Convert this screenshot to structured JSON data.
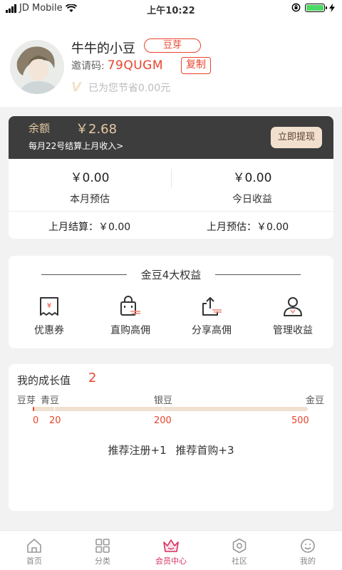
{
  "status_bar": {
    "carrier": "JD Mobile",
    "time": "上午10:22"
  },
  "profile": {
    "name": "牛牛的小豆",
    "level": "豆芽",
    "invite_label": "邀请码:",
    "invite_code": "79QUGM",
    "copy_label": "复制",
    "saved_text": "已为您节省0.00元"
  },
  "balance": {
    "label": "余额",
    "value": "￥2.68",
    "note": "每月22号结算上月收入>",
    "withdraw_label": "立即提现",
    "month_estimate_value": "￥0.00",
    "month_estimate_label": "本月预估",
    "today_income_value": "￥0.00",
    "today_income_label": "今日收益",
    "last_settle": "上月结算：￥0.00",
    "last_estimate": "上月预估：￥0.00"
  },
  "benefits": {
    "title": "金豆4大权益",
    "items": [
      {
        "label": "优惠券",
        "icon": "coupon-icon"
      },
      {
        "label": "直购高佣",
        "icon": "shopping-bag-icon"
      },
      {
        "label": "分享高佣",
        "icon": "share-icon"
      },
      {
        "label": "管理收益",
        "icon": "user-manage-icon"
      }
    ]
  },
  "growth": {
    "title": "我的成长值",
    "value": "2",
    "progress_value": 2,
    "max_value": 500,
    "stages": [
      {
        "label": "豆芽",
        "threshold": "0"
      },
      {
        "label": "青豆",
        "threshold": "20"
      },
      {
        "label": "银豆",
        "threshold": "200"
      },
      {
        "label": "金豆",
        "threshold": "500"
      }
    ],
    "tips": "推荐注册+1 推荐首购+3"
  },
  "tabbar": {
    "items": [
      {
        "label": "首页",
        "icon": "home-icon"
      },
      {
        "label": "分类",
        "icon": "category-icon"
      },
      {
        "label": "会员中心",
        "icon": "crown-icon",
        "active": true
      },
      {
        "label": "社区",
        "icon": "community-icon"
      },
      {
        "label": "我的",
        "icon": "profile-icon"
      }
    ]
  },
  "colors": {
    "accent": "#e8442c",
    "active_tab": "#d5305f",
    "card_dark": "#3d3d3d",
    "gold_text": "#e6c9a3"
  }
}
